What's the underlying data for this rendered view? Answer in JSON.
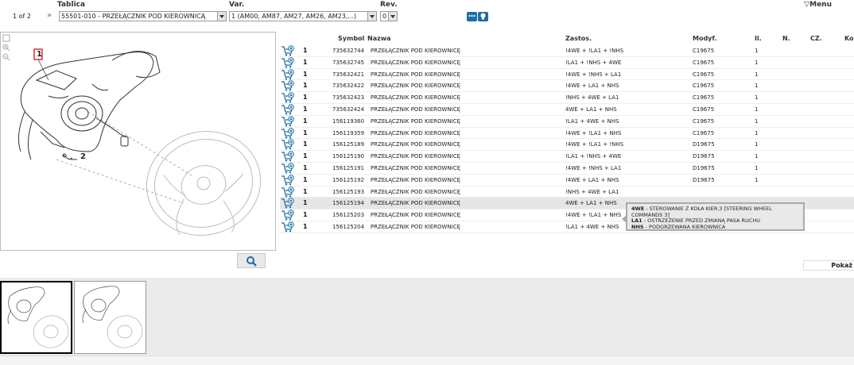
{
  "header": {
    "labels": {
      "tablica": "Tablica",
      "var": "Var.",
      "rev": "Rev."
    },
    "pager": "1 of 2",
    "nav_arrows": "»",
    "tablica_value": "55501-010 - PRZEŁĄCZNIK POD KIEROWNICĄ",
    "var_value": "1 (AM00, AM87, AM27, AM26, AM23,...)",
    "rev_value": "0",
    "menu_label": "Menu",
    "menu_icon": "▽"
  },
  "diagram": {
    "callouts": [
      "1",
      "2"
    ],
    "search_icon": "search-icon"
  },
  "table": {
    "columns": [
      "Symbol",
      "Nazwa",
      "Zastos.",
      "Modyf.",
      "Il.",
      "N.",
      "CZ.",
      "Ko"
    ],
    "rows": [
      {
        "qty": "1",
        "symbol": "735632744",
        "name": "PRZEŁĄCZNIK POD KIEROWNICĘ",
        "zastos": "!4WE + !LA1 + !NHS",
        "modyf": "C19675",
        "il": "1"
      },
      {
        "qty": "1",
        "symbol": "735632745",
        "name": "PRZEŁĄCZNIK POD KIEROWNICĘ",
        "zastos": "!LA1 + !NHS + 4WE",
        "modyf": "C19675",
        "il": "1"
      },
      {
        "qty": "1",
        "symbol": "735632421",
        "name": "PRZEŁĄCZNIK POD KIEROWNICĘ",
        "zastos": "!4WE + !NHS + LA1",
        "modyf": "C19675",
        "il": "1"
      },
      {
        "qty": "1",
        "symbol": "735632422",
        "name": "PRZEŁĄCZNIK POD KIEROWNICĘ",
        "zastos": "!4WE + LA1 + NHS",
        "modyf": "C19675",
        "il": "1"
      },
      {
        "qty": "1",
        "symbol": "735632423",
        "name": "PRZEŁĄCZNIK POD KIEROWNICĘ",
        "zastos": "!NHS + 4WE + LA1",
        "modyf": "C19675",
        "il": "1"
      },
      {
        "qty": "1",
        "symbol": "735632424",
        "name": "PRZEŁĄCZNIK POD KIEROWNICĘ",
        "zastos": "4WE + LA1 + NHS",
        "modyf": "C19675",
        "il": "1"
      },
      {
        "qty": "1",
        "symbol": "156119360",
        "name": "PRZEŁĄCZNIK POD KIEROWNICĘ",
        "zastos": "!LA1 + 4WE + NHS",
        "modyf": "C19675",
        "il": "1"
      },
      {
        "qty": "1",
        "symbol": "156119359",
        "name": "PRZEŁĄCZNIK POD KIEROWNICĘ",
        "zastos": "!4WE + !LA1 + NHS",
        "modyf": "C19675",
        "il": "1"
      },
      {
        "qty": "1",
        "symbol": "156125189",
        "name": "PRZEŁĄCZNIK POD KIEROWNICĘ",
        "zastos": "!4WE + !LA1 + !NHS",
        "modyf": "D19675",
        "il": "1"
      },
      {
        "qty": "1",
        "symbol": "156125190",
        "name": "PRZEŁĄCZNIK POD KIEROWNICĘ",
        "zastos": "!LA1 + !NHS + 4WE",
        "modyf": "D19675",
        "il": "1"
      },
      {
        "qty": "1",
        "symbol": "156125191",
        "name": "PRZEŁĄCZNIK POD KIEROWNICĘ",
        "zastos": "!4WE + !NHS + LA1",
        "modyf": "D19675",
        "il": "1"
      },
      {
        "qty": "1",
        "symbol": "156125192",
        "name": "PRZEŁĄCZNIK POD KIEROWNICĘ",
        "zastos": "!4WE + LA1 + NHS",
        "modyf": "D19675",
        "il": "1"
      },
      {
        "qty": "1",
        "symbol": "156125193",
        "name": "PRZEŁĄCZNIK POD KIEROWNICĘ",
        "zastos": "!NHS + 4WE + LA1",
        "modyf": "",
        "il": ""
      },
      {
        "qty": "1",
        "symbol": "156125194",
        "name": "PRZEŁĄCZNIK POD KIEROWNICĘ",
        "zastos": "4WE + LA1 + NHS",
        "modyf": "",
        "il": ""
      },
      {
        "qty": "1",
        "symbol": "156125203",
        "name": "PRZEŁĄCZNIK POD KIEROWNICĘ",
        "zastos": "!4WE + !LA1 + NHS",
        "modyf": "",
        "il": ""
      },
      {
        "qty": "1",
        "symbol": "156125204",
        "name": "PRZEŁĄCZNIK POD KIEROWNICĘ",
        "zastos": "!LA1 + 4WE + NHS",
        "modyf": "D19675",
        "il": "1"
      }
    ],
    "highlighted_row": 13
  },
  "tooltip": {
    "line1_code": "4WE",
    "line1_text": " - STEROWANIE Z KOŁA KIER.3 [STEERING WHEEL COMMANDS 3]",
    "line2_code": "LA1",
    "line2_text": " - OSTRZEŻENIE PRZED ZMIANĄ PASA RUCHU",
    "line3_code": "NHS",
    "line3_text": " - PODGRZEWANA KIEROWNICA"
  },
  "pokaz_label": "Pokaż",
  "colors": {
    "accent": "#1d6fa5",
    "callout": "#d00000",
    "cart": "#1d6fa5"
  }
}
